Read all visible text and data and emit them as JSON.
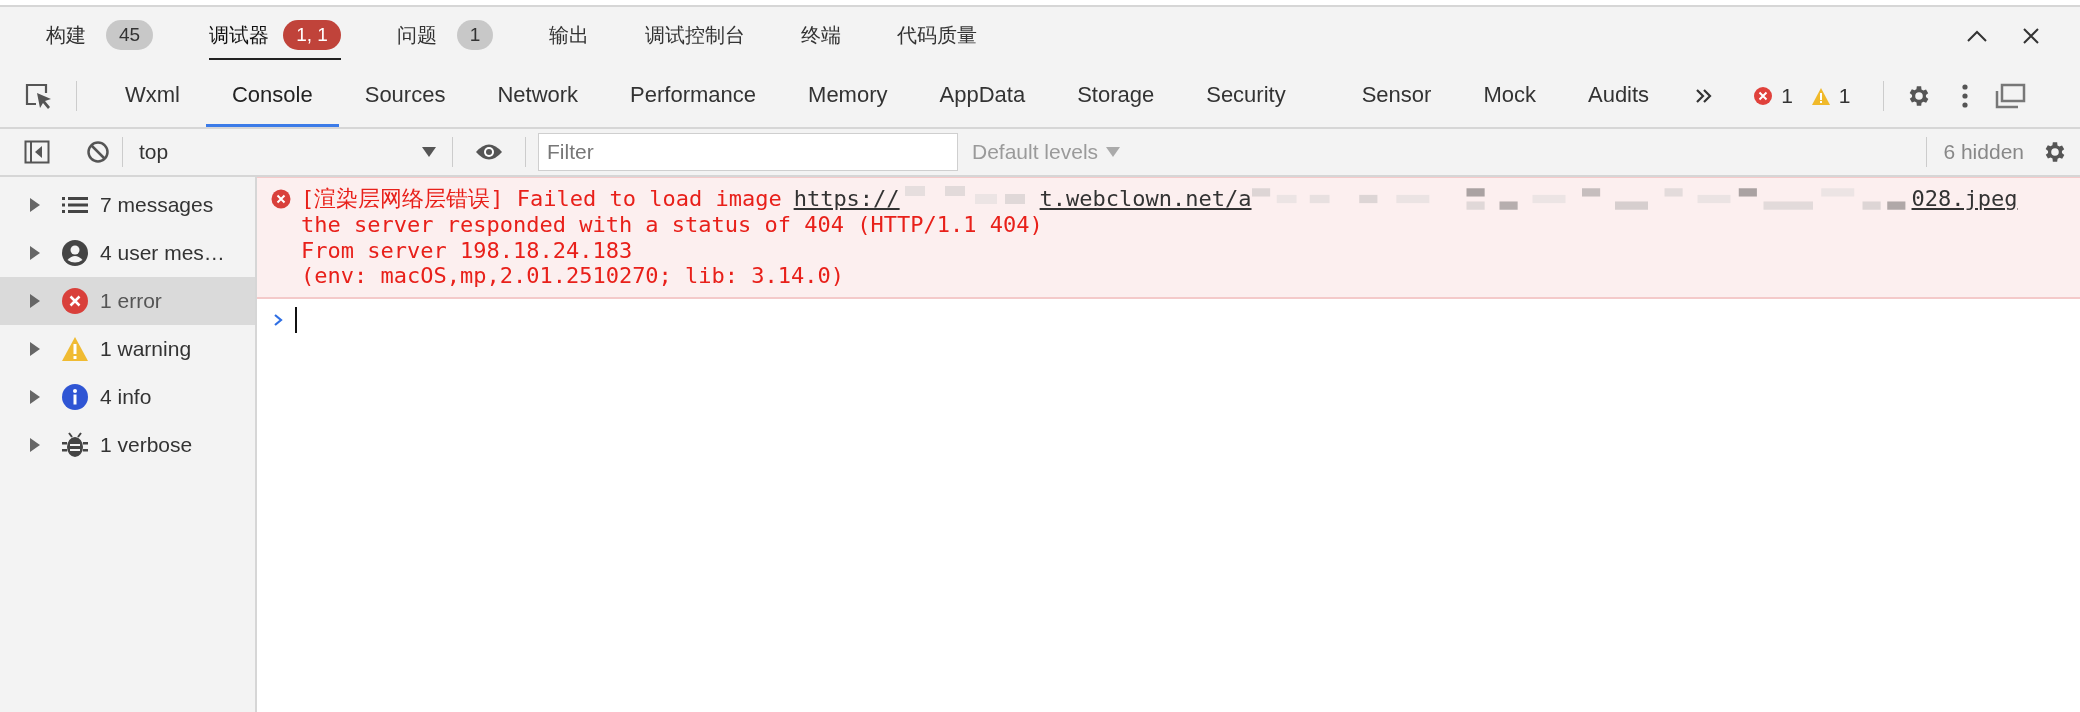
{
  "panel_tabs": [
    {
      "label": "构建",
      "selected": false,
      "badge": {
        "text": "45",
        "kind": "neutral"
      }
    },
    {
      "label": "调试器",
      "selected": true,
      "badge": {
        "text": "1, 1",
        "kind": "alert"
      }
    },
    {
      "label": "问题",
      "selected": false,
      "badge": {
        "text": "1",
        "kind": "neutral"
      }
    },
    {
      "label": "输出",
      "selected": false
    },
    {
      "label": "调试控制台",
      "selected": false
    },
    {
      "label": "终端",
      "selected": false
    },
    {
      "label": "代码质量",
      "selected": false
    }
  ],
  "devtools_tabs": [
    {
      "label": "Wxml",
      "selected": false
    },
    {
      "label": "Console",
      "selected": true
    },
    {
      "label": "Sources",
      "selected": false
    },
    {
      "label": "Network",
      "selected": false
    },
    {
      "label": "Performance",
      "selected": false
    },
    {
      "label": "Memory",
      "selected": false
    },
    {
      "label": "AppData",
      "selected": false
    },
    {
      "label": "Storage",
      "selected": false
    },
    {
      "label": "Security",
      "selected": false
    },
    {
      "label": "Sensor",
      "selected": false
    },
    {
      "label": "Mock",
      "selected": false
    },
    {
      "label": "Audits",
      "selected": false
    }
  ],
  "issue_counts": {
    "errors": "1",
    "warnings": "1"
  },
  "console_toolbar": {
    "context": "top",
    "filter_placeholder": "Filter",
    "levels": "Default levels",
    "hidden_count": "6 hidden"
  },
  "sidebar": {
    "items": [
      {
        "kind": "list",
        "label": "7 messages",
        "selected": false
      },
      {
        "kind": "user",
        "label": "4 user mes…",
        "selected": false
      },
      {
        "kind": "error",
        "label": "1 error",
        "selected": true
      },
      {
        "kind": "warning",
        "label": "1 warning",
        "selected": false
      },
      {
        "kind": "info",
        "label": "4 info",
        "selected": false
      },
      {
        "kind": "verbose",
        "label": "1 verbose",
        "selected": false
      }
    ]
  },
  "messages": [
    {
      "kind": "error",
      "text": "[渲染层网络层错误] Failed to load image",
      "link_parts": [
        "https://",
        "t.webclown.net/a",
        "028.jpeg"
      ],
      "lines": [
        "the server responded with a status of 404 (HTTP/1.1 404)",
        "From server 198.18.24.183",
        "(env: macOS,mp,2.01.2510270; lib: 3.14.0)"
      ]
    }
  ]
}
